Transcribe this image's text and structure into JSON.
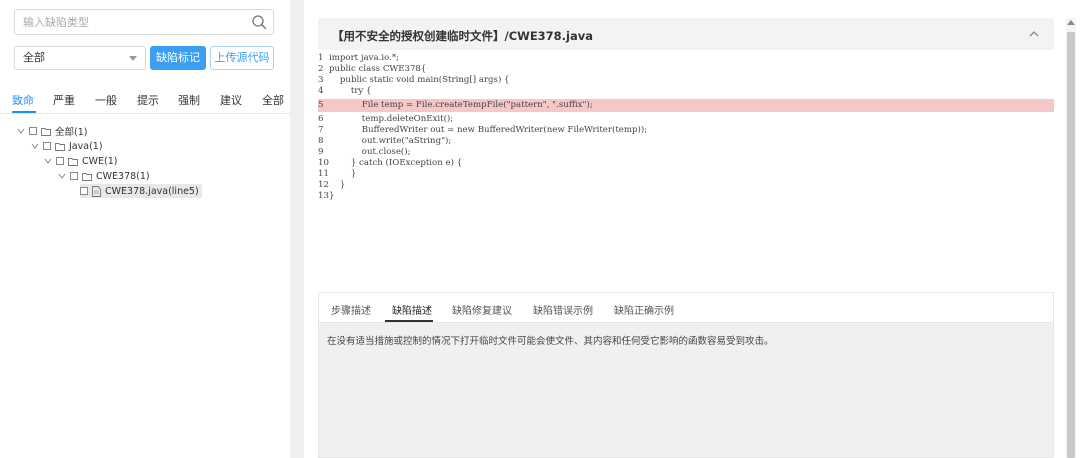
{
  "left": {
    "search": {
      "placeholder": "输入缺陷类型",
      "icon": "search-icon"
    },
    "select": {
      "value": "全部"
    },
    "buttons": {
      "mark": "缺陷标记",
      "upload": "上传源代码"
    },
    "tabs": [
      "致命",
      "严重",
      "一般",
      "提示",
      "强制",
      "建议",
      "全部"
    ],
    "active_tab": "致命",
    "tree": [
      {
        "label": "全部(1)",
        "depth": 0,
        "type": "folder",
        "expanded": true
      },
      {
        "label": "Java(1)",
        "depth": 1,
        "type": "folder",
        "expanded": true
      },
      {
        "label": "CWE(1)",
        "depth": 2,
        "type": "folder",
        "expanded": true
      },
      {
        "label": "CWE378(1)",
        "depth": 3,
        "type": "folder",
        "expanded": true
      },
      {
        "label": "CWE378.java(line5)",
        "depth": 4,
        "type": "file",
        "expanded": false
      }
    ]
  },
  "code_panel": {
    "title": "【用不安全的授权创建临时文件】/CWE378.java",
    "highlight_line": 5,
    "lines": [
      {
        "n": "1",
        "text": "import java.io.*;"
      },
      {
        "n": "2",
        "text": "public class CWE378{"
      },
      {
        "n": "3",
        "text": "    public static void main(String[] args) {"
      },
      {
        "n": "4",
        "text": "        try {"
      },
      {
        "n": "5",
        "text": "            File temp = File.createTempFile(\"pattern\", \".suffix\");"
      },
      {
        "n": "6",
        "text": "            temp.deleteOnExit();"
      },
      {
        "n": "7",
        "text": "            BufferedWriter out = new BufferedWriter(new FileWriter(temp));"
      },
      {
        "n": "8",
        "text": "            out.write(\"aString\");"
      },
      {
        "n": "9",
        "text": "            out.close();"
      },
      {
        "n": "10",
        "text": "        } catch (IOException e) {"
      },
      {
        "n": "11",
        "text": "        }"
      },
      {
        "n": "12",
        "text": "    }"
      },
      {
        "n": "13",
        "text": "}"
      }
    ]
  },
  "detail": {
    "tabs": [
      "步骤描述",
      "缺陷描述",
      "缺陷修复建议",
      "缺陷错误示例",
      "缺陷正确示例"
    ],
    "active_tab": "缺陷描述",
    "text": "在没有适当措施或控制的情况下打开临时文件可能会使文件、其内容和任何受它影响的函数容易受到攻击。"
  },
  "colors": {
    "primary": "#3a9ff2",
    "active_tab": "#1890ff",
    "highlight": "#f7c6c6"
  }
}
